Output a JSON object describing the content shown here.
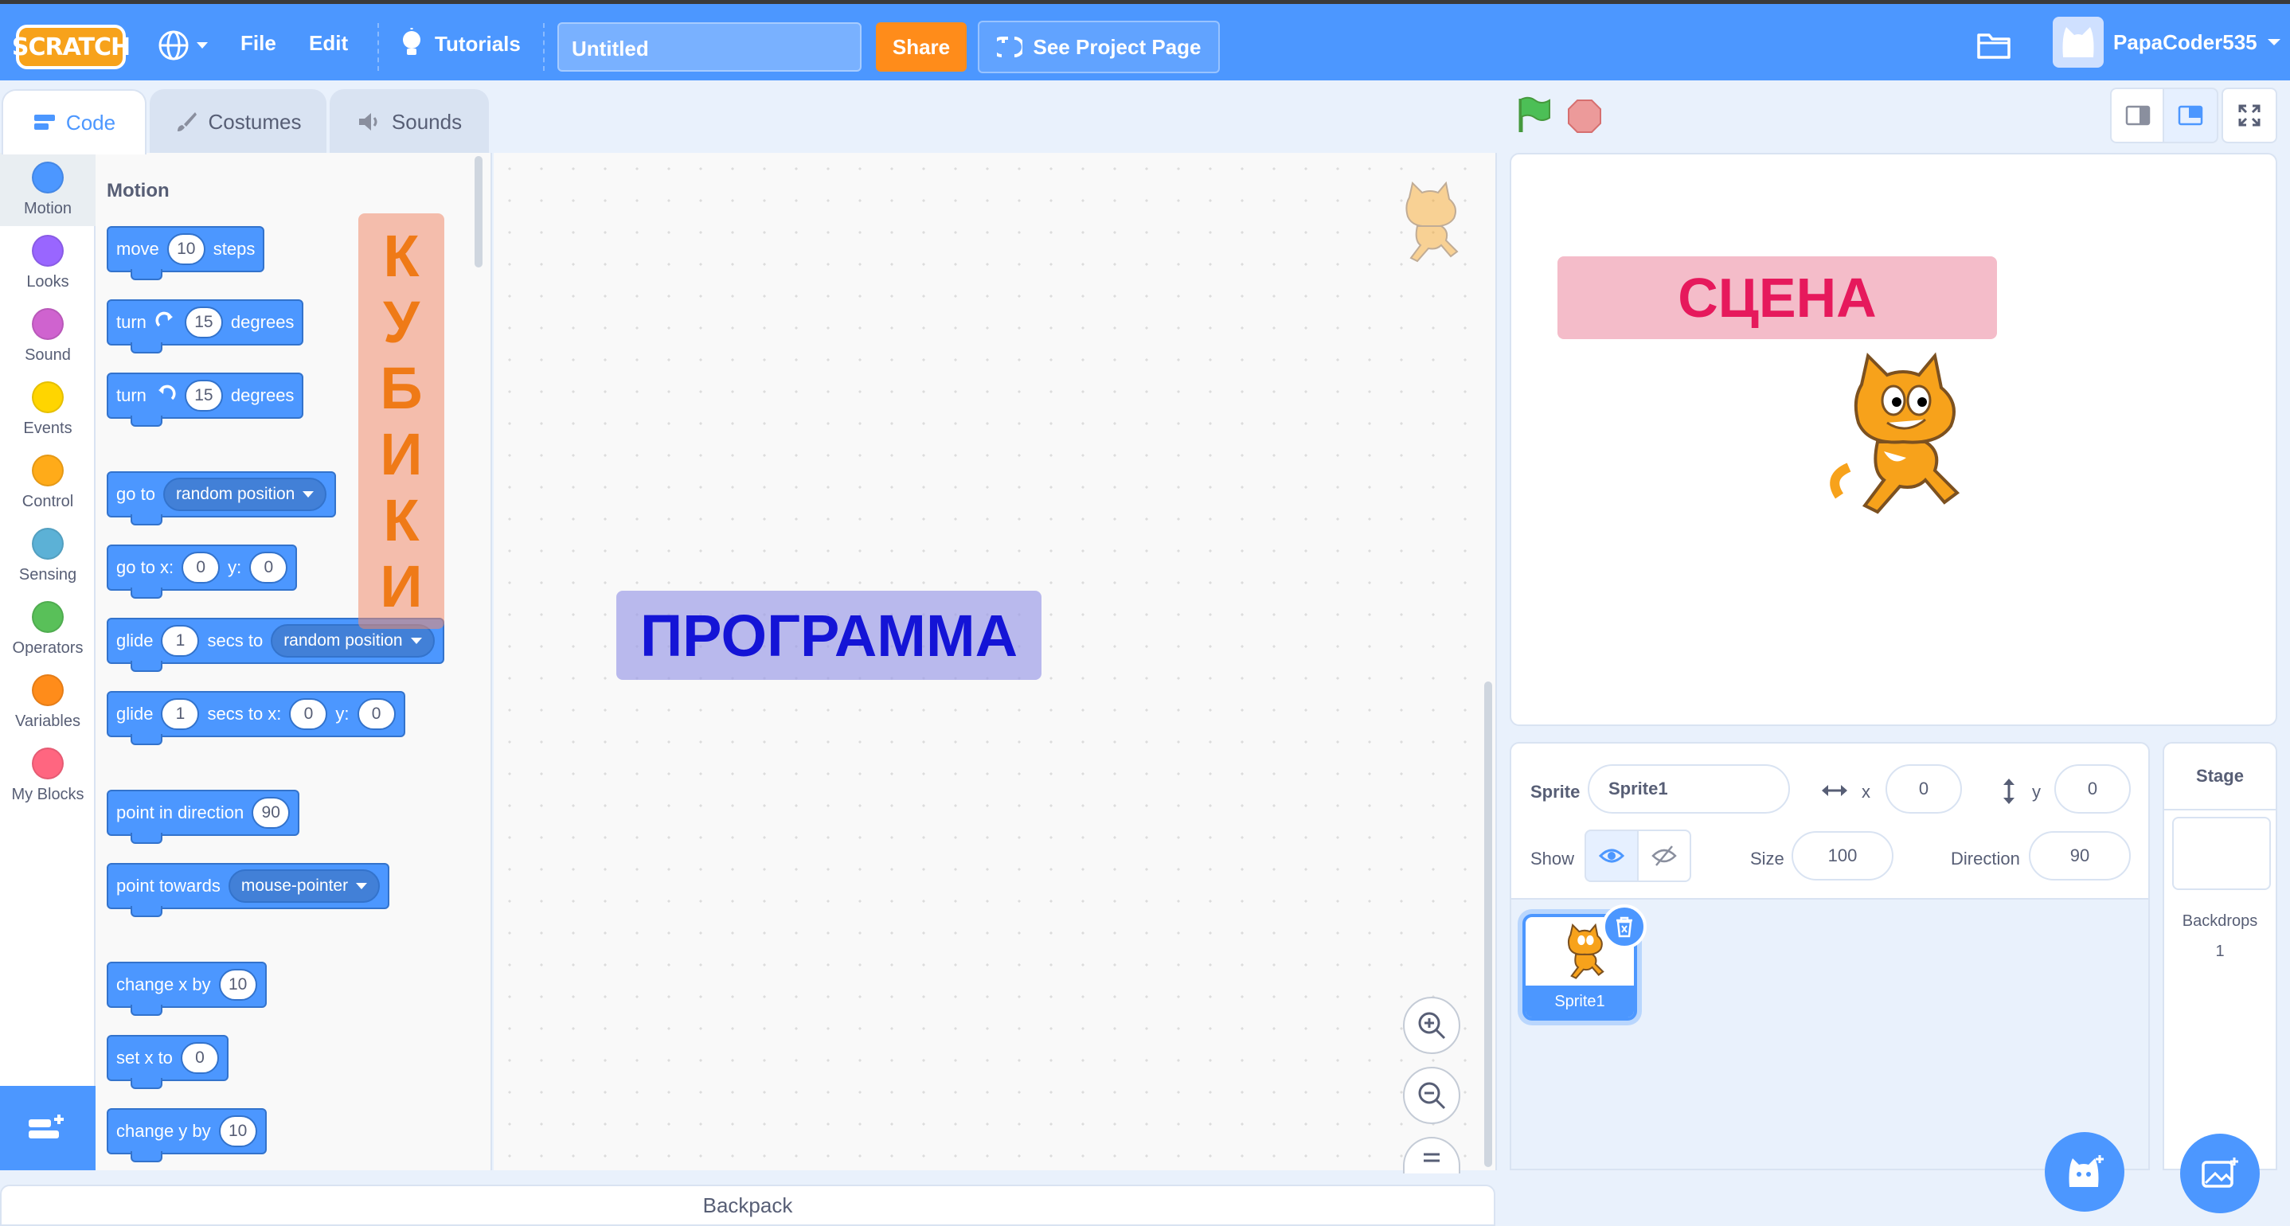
{
  "menubar": {
    "logo": "SCRATCH",
    "file": "File",
    "edit": "Edit",
    "tutorials": "Tutorials",
    "project_title": "Untitled",
    "share": "Share",
    "see_project_page": "See Project Page",
    "username": "PapaCoder535",
    "accent": "#4c97ff"
  },
  "tabs": [
    {
      "label": "Code",
      "icon": "code-icon"
    },
    {
      "label": "Costumes",
      "icon": "brush-icon"
    },
    {
      "label": "Sounds",
      "icon": "speaker-icon"
    }
  ],
  "categories": [
    {
      "label": "Motion",
      "color": "#4c97ff"
    },
    {
      "label": "Looks",
      "color": "#9966ff"
    },
    {
      "label": "Sound",
      "color": "#cf63cf"
    },
    {
      "label": "Events",
      "color": "#ffd500"
    },
    {
      "label": "Control",
      "color": "#ffab19"
    },
    {
      "label": "Sensing",
      "color": "#5cb1d6"
    },
    {
      "label": "Operators",
      "color": "#59c059"
    },
    {
      "label": "Variables",
      "color": "#ff8c1a"
    },
    {
      "label": "My Blocks",
      "color": "#ff6680"
    }
  ],
  "flyout": {
    "heading": "Motion",
    "blocks": {
      "move": {
        "a": "move",
        "v": "10",
        "b": "steps"
      },
      "turn_right": {
        "a": "turn",
        "v": "15",
        "b": "degrees"
      },
      "turn_left": {
        "a": "turn",
        "v": "15",
        "b": "degrees"
      },
      "go_to": {
        "a": "go to",
        "dd": "random position"
      },
      "go_to_xy": {
        "a": "go to x:",
        "x": "0",
        "b": "y:",
        "y": "0"
      },
      "glide_to": {
        "a": "glide",
        "v": "1",
        "b": "secs to",
        "dd": "random position"
      },
      "glide_xy": {
        "a": "glide",
        "v": "1",
        "b": "secs to x:",
        "x": "0",
        "c": "y:",
        "y": "0"
      },
      "point_dir": {
        "a": "point in direction",
        "v": "90"
      },
      "point_towards": {
        "a": "point towards",
        "dd": "mouse-pointer"
      },
      "change_x": {
        "a": "change x by",
        "v": "10"
      },
      "set_x": {
        "a": "set x to",
        "v": "0"
      },
      "change_y": {
        "a": "change y by",
        "v": "10"
      }
    }
  },
  "annotations": {
    "kubiki": [
      "К",
      "У",
      "Б",
      "И",
      "К",
      "И"
    ],
    "programma": "ПРОГРАММА",
    "scena": "СЦЕНА"
  },
  "sprite_info": {
    "sprite_label": "Sprite",
    "sprite_name": "Sprite1",
    "x_label": "x",
    "x_value": "0",
    "y_label": "y",
    "y_value": "0",
    "show_label": "Show",
    "size_label": "Size",
    "size_value": "100",
    "direction_label": "Direction",
    "direction_value": "90"
  },
  "sprites": [
    {
      "name": "Sprite1"
    }
  ],
  "stage_pane": {
    "title": "Stage",
    "backdrops_label": "Backdrops",
    "backdrops_count": "1"
  },
  "backpack": "Backpack"
}
